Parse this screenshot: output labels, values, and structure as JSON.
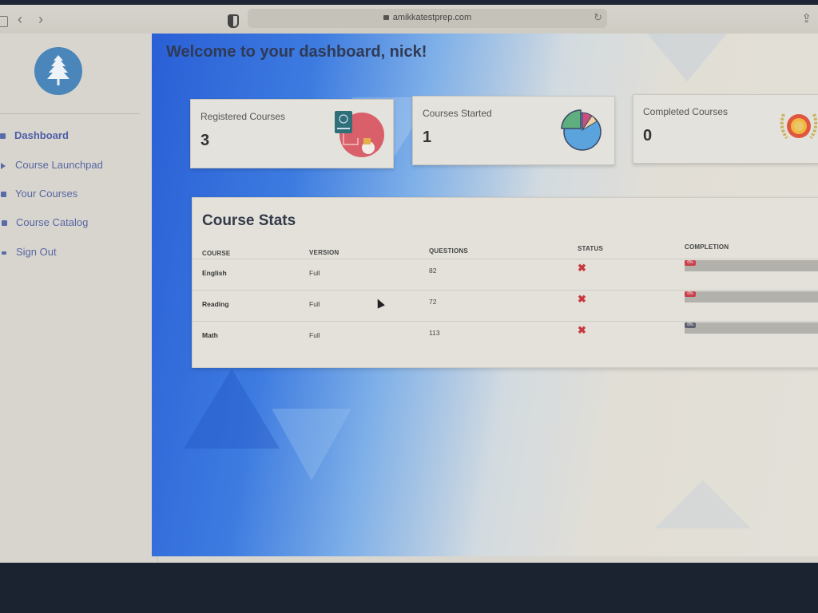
{
  "browser": {
    "url": "amikkatestprep.com",
    "back_icon": "chevron-left-icon",
    "forward_icon": "chevron-right-icon",
    "reload_icon": "reload-icon",
    "share_icon": "share-icon"
  },
  "sidebar": {
    "logo_icon": "tree-icon",
    "items": [
      {
        "label": "Dashboard",
        "icon": "home-icon",
        "active": true
      },
      {
        "label": "Course Launchpad",
        "icon": "play-icon",
        "active": false
      },
      {
        "label": "Your Courses",
        "icon": "folder-icon",
        "active": false
      },
      {
        "label": "Course Catalog",
        "icon": "book-icon",
        "active": false
      },
      {
        "label": "Sign Out",
        "icon": "sign-out-icon",
        "active": false
      }
    ]
  },
  "main": {
    "welcome": "Welcome to your dashboard, nick!",
    "cards": [
      {
        "label": "Registered Courses",
        "value": "3",
        "icon": "passport-icon"
      },
      {
        "label": "Courses Started",
        "value": "1",
        "icon": "pie-chart-icon"
      },
      {
        "label": "Completed Courses",
        "value": "0",
        "icon": "medal-icon"
      }
    ],
    "course_stats": {
      "title": "Course Stats",
      "headers": [
        "COURSE",
        "VERSION",
        "QUESTIONS",
        "STATUS",
        "COMPLETION"
      ],
      "rows": [
        {
          "course": "English",
          "version": "Full",
          "questions": "82",
          "status": "incomplete",
          "completion_pct": 0,
          "completion_label": "0%",
          "color": "#c9404a"
        },
        {
          "course": "Reading",
          "version": "Full",
          "questions": "72",
          "status": "incomplete",
          "completion_pct": 0,
          "completion_label": "0%",
          "color": "#c9404a"
        },
        {
          "course": "Math",
          "version": "Full",
          "questions": "113",
          "status": "incomplete",
          "completion_pct": 0,
          "completion_label": "0%",
          "color": "#5f6172"
        }
      ],
      "status_icon": "x-icon",
      "status_color": "#c9383f"
    }
  }
}
